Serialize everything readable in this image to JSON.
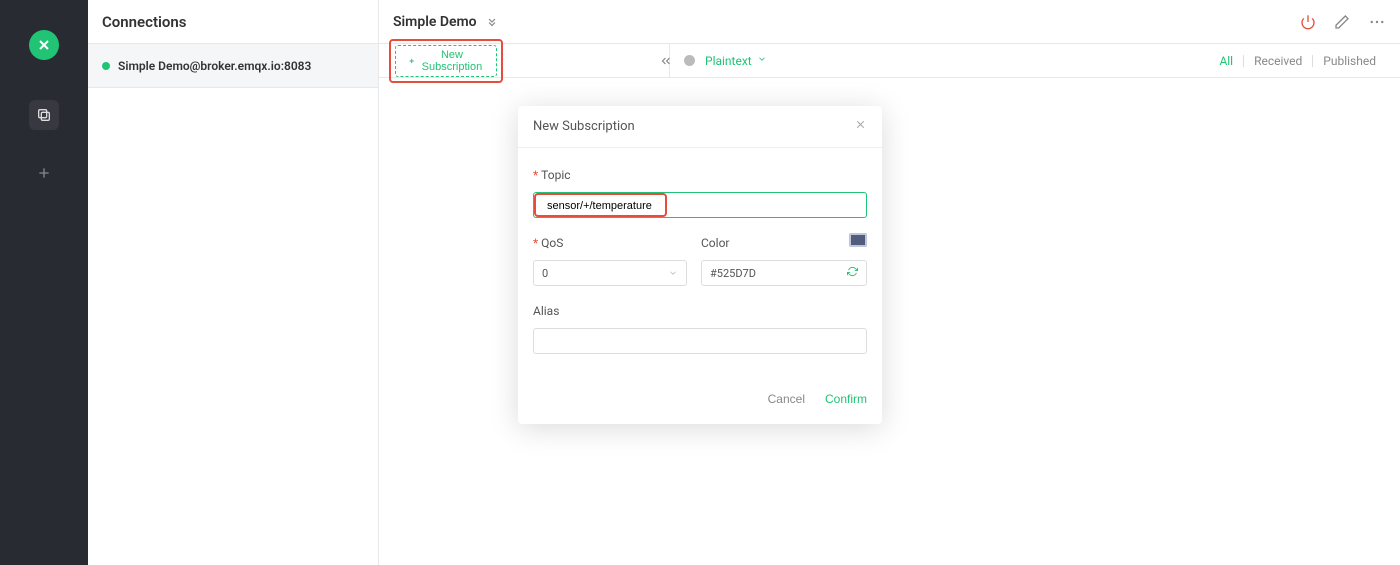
{
  "sidebar": {
    "logo_text": "X"
  },
  "connections": {
    "header_title": "Connections",
    "items": [
      {
        "name": "Simple Demo@broker.emqx.io:8083"
      }
    ]
  },
  "main": {
    "title": "Simple Demo",
    "new_sub_btn": "New Subscription",
    "plaintext_label": "Plaintext",
    "filter_tabs": {
      "all": "All",
      "received": "Received",
      "published": "Published"
    }
  },
  "modal": {
    "title": "New Subscription",
    "topic_label": "Topic",
    "topic_value": "sensor/+/temperature",
    "qos_label": "QoS",
    "qos_value": "0",
    "color_label": "Color",
    "color_value": "#525D7D",
    "alias_label": "Alias",
    "alias_value": "",
    "cancel": "Cancel",
    "confirm": "Confirm"
  }
}
